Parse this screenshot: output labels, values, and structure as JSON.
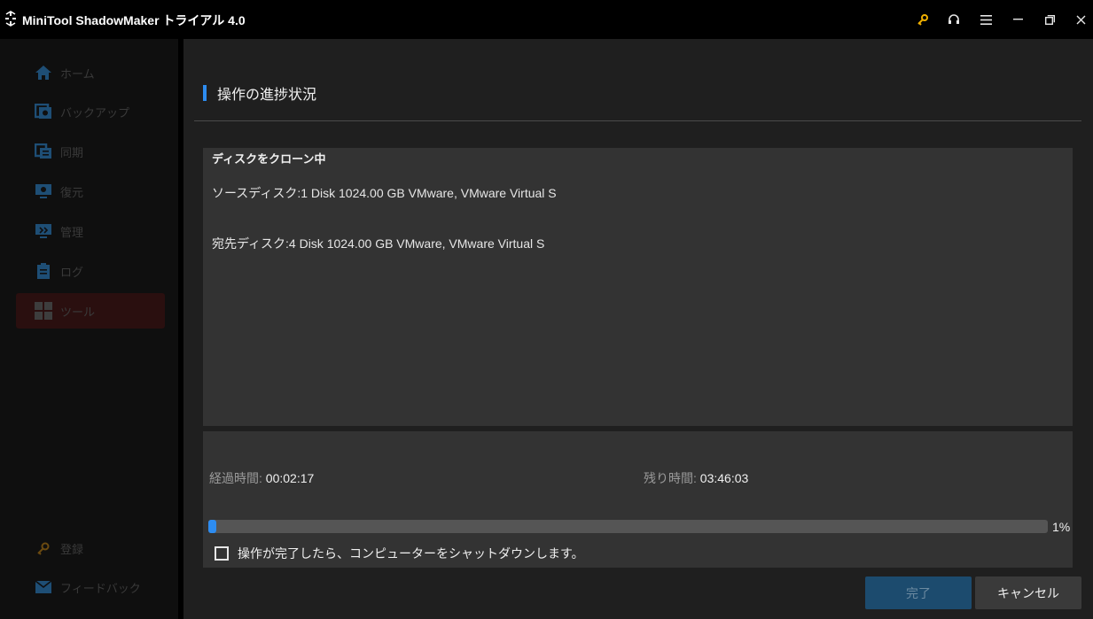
{
  "window": {
    "title": "MiniTool ShadowMaker トライアル 4.0",
    "accent_color": "#2d8cf0",
    "key_icon_color": "#f0b000"
  },
  "title_controls": [
    "key-icon",
    "headset-icon",
    "menu-icon",
    "minimize-icon",
    "restore-icon",
    "close-icon"
  ],
  "sidebar": {
    "items": [
      {
        "label": "ホーム",
        "icon": "home-icon"
      },
      {
        "label": "バックアップ",
        "icon": "backup-icon"
      },
      {
        "label": "同期",
        "icon": "sync-icon"
      },
      {
        "label": "復元",
        "icon": "restore-icon"
      },
      {
        "label": "管理",
        "icon": "manage-icon"
      },
      {
        "label": "ログ",
        "icon": "log-icon"
      },
      {
        "label": "ツール",
        "icon": "tools-icon",
        "active": true
      }
    ],
    "bottom_items": [
      {
        "label": "登録",
        "icon": "key-icon"
      },
      {
        "label": "フィードバック",
        "icon": "mail-icon"
      }
    ]
  },
  "main": {
    "title": "操作の進捗状況",
    "status_heading": "ディスクをクローン中",
    "source_line": "ソースディスク:1 Disk 1024.00 GB VMware, VMware Virtual S",
    "dest_line": "宛先ディスク:4 Disk 1024.00 GB VMware, VMware Virtual S",
    "elapsed_label": "経過時間:",
    "elapsed_value": "00:02:17",
    "remaining_label": "残り時間:",
    "remaining_value": "03:46:03",
    "progress_percent": 1,
    "progress_text": "1%",
    "shutdown_label": "操作が完了したら、コンピューターをシャットダウンします。",
    "shutdown_checked": false,
    "finish_button": "完了",
    "cancel_button": "キャンセル"
  }
}
